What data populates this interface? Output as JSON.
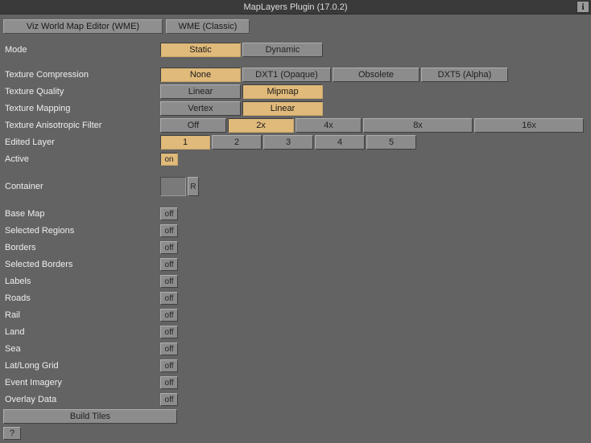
{
  "title": "MapLayers Plugin (17.0.2)",
  "info_icon": "i",
  "tabs": {
    "wme": "Viz World Map Editor (WME)",
    "classic": "WME (Classic)"
  },
  "rows": {
    "mode": {
      "label": "Mode",
      "options": [
        "Static",
        "Dynamic"
      ],
      "selected": 0
    },
    "tex_comp": {
      "label": "Texture Compression",
      "options": [
        "None",
        "DXT1 (Opaque)",
        "Obsolete",
        "DXT5 (Alpha)"
      ],
      "selected": 0
    },
    "tex_qual": {
      "label": "Texture Quality",
      "options": [
        "Linear",
        "Mipmap"
      ],
      "selected": 1
    },
    "tex_map": {
      "label": "Texture Mapping",
      "options": [
        "Vertex",
        "Linear"
      ],
      "selected": 1
    },
    "aniso": {
      "label": "Texture Anisotropic Filter",
      "options": [
        "Off",
        "2x",
        "4x",
        "8x",
        "16x"
      ],
      "selected": 1
    },
    "edit_layer": {
      "label": "Edited Layer",
      "options": [
        "1",
        "2",
        "3",
        "4",
        "5"
      ],
      "selected": 0
    },
    "active": {
      "label": "Active",
      "state": "on"
    },
    "container": {
      "label": "Container",
      "reset": "R"
    }
  },
  "toggles": [
    {
      "key": "base_map",
      "label": "Base Map",
      "state": "off"
    },
    {
      "key": "sel_regions",
      "label": "Selected Regions",
      "state": "off"
    },
    {
      "key": "borders",
      "label": "Borders",
      "state": "off"
    },
    {
      "key": "sel_borders",
      "label": "Selected Borders",
      "state": "off"
    },
    {
      "key": "labels",
      "label": "Labels",
      "state": "off"
    },
    {
      "key": "roads",
      "label": "Roads",
      "state": "off"
    },
    {
      "key": "rail",
      "label": "Rail",
      "state": "off"
    },
    {
      "key": "land",
      "label": "Land",
      "state": "off"
    },
    {
      "key": "sea",
      "label": "Sea",
      "state": "off"
    },
    {
      "key": "latlong",
      "label": "Lat/Long Grid",
      "state": "off"
    },
    {
      "key": "event_img",
      "label": "Event Imagery",
      "state": "off"
    },
    {
      "key": "overlay",
      "label": "Overlay Data",
      "state": "off"
    }
  ],
  "buttons": {
    "build": "Build Tiles",
    "help": "?"
  }
}
